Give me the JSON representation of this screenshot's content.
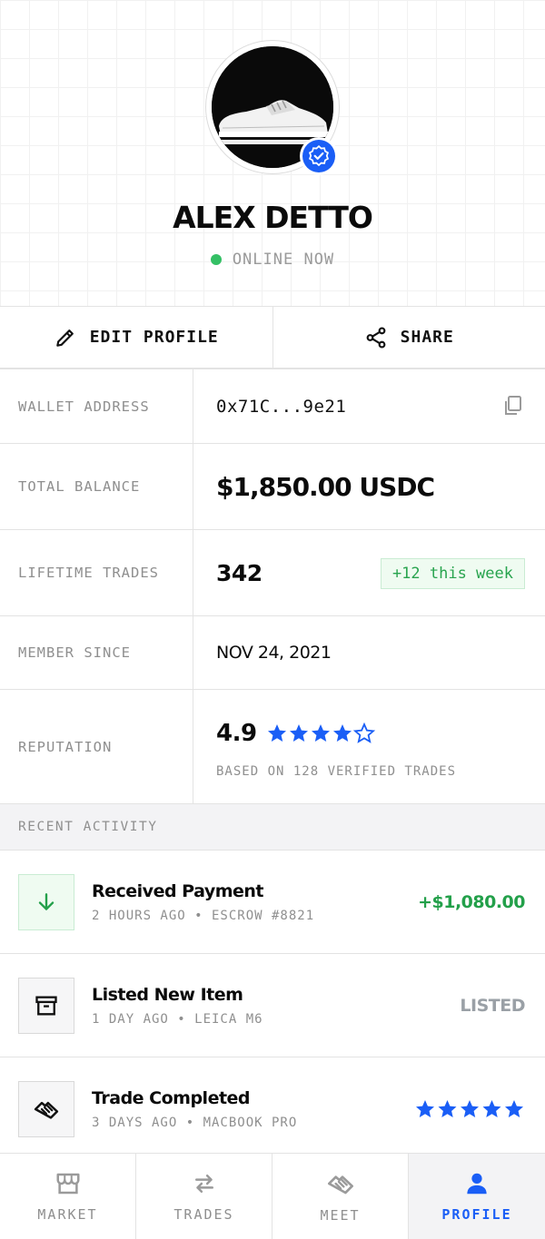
{
  "colors": {
    "accent": "#1a5ef6",
    "online": "#34c065",
    "positive": "#23a04a",
    "muted": "#8f8f8f"
  },
  "profile": {
    "avatar_icon": "sneaker-image",
    "verified_icon": "verified-badge-icon",
    "name": "ALEX DETTO",
    "status": "ONLINE NOW"
  },
  "actions": {
    "edit_label": "EDIT PROFILE",
    "share_label": "SHARE"
  },
  "info": {
    "wallet_label": "WALLET ADDRESS",
    "wallet_value": "0x71C...9e21",
    "balance_label": "TOTAL BALANCE",
    "balance_value": "$1,850.00 USDC",
    "trades_label": "LIFETIME TRADES",
    "trades_value": "342",
    "trades_badge": "+12 this week",
    "member_label": "MEMBER SINCE",
    "member_value": "NOV 24, 2021",
    "rep_label": "REPUTATION",
    "rep_score": "4.9",
    "rep_rating": 4.5,
    "rep_sub": "BASED ON 128 VERIFIED TRADES"
  },
  "activity": {
    "heading": "RECENT ACTIVITY",
    "items": [
      {
        "title": "Received Payment",
        "meta": "2 HOURS AGO • ESCROW #8821",
        "right": "+$1,080.00",
        "icon": "arrow-down-icon"
      },
      {
        "title": "Listed New Item",
        "meta": "1 DAY AGO • LEICA M6",
        "right": "LISTED",
        "icon": "archive-box-icon"
      },
      {
        "title": "Trade Completed",
        "meta": "3 DAYS AGO • MACBOOK PRO",
        "rating": 5,
        "icon": "handshake-icon"
      }
    ]
  },
  "nav": {
    "items": [
      {
        "label": "MARKET",
        "icon": "store-icon"
      },
      {
        "label": "TRADES",
        "icon": "swap-arrows-icon"
      },
      {
        "label": "MEET",
        "icon": "handshake-icon"
      },
      {
        "label": "PROFILE",
        "icon": "user-icon",
        "active": true
      }
    ]
  }
}
